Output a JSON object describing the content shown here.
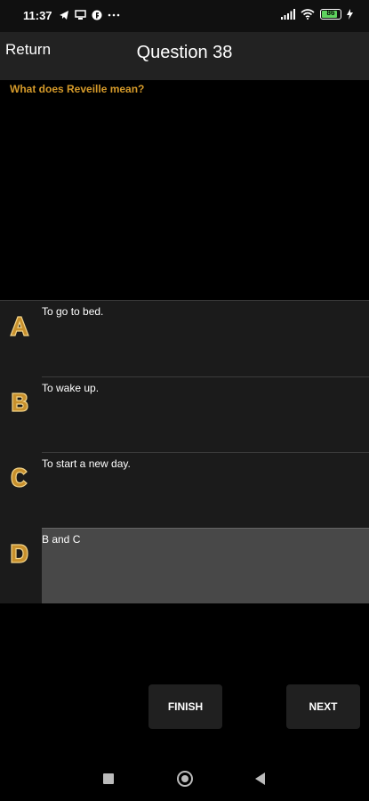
{
  "status_bar": {
    "time": "11:37",
    "battery": "86",
    "icons": [
      "telegram-icon",
      "monitor-icon",
      "app-icon",
      "more-dots-icon",
      "signal-icon",
      "wifi-icon",
      "battery-icon",
      "charging-icon"
    ]
  },
  "header": {
    "return_label": "Return",
    "title": "Question 38"
  },
  "question": {
    "text": "What does Reveille mean?"
  },
  "answers": [
    {
      "letter": "A",
      "text": "To go to bed.",
      "selected": false
    },
    {
      "letter": "B",
      "text": "To wake up.",
      "selected": false
    },
    {
      "letter": "C",
      "text": "To start a new day.",
      "selected": false
    },
    {
      "letter": "D",
      "text": "B and C",
      "selected": true
    }
  ],
  "buttons": {
    "finish_label": "FINISH",
    "next_label": "NEXT"
  },
  "colors": {
    "accent": "#d59a2a",
    "header_bg": "#222222",
    "answer_bg": "#1b1b1b",
    "selected_bg": "#484848"
  }
}
